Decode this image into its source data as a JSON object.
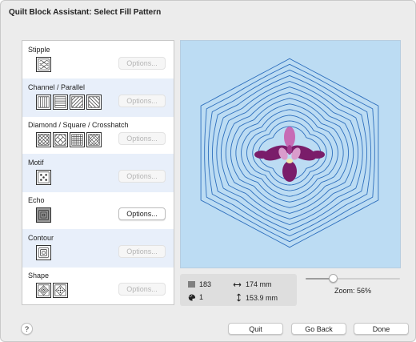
{
  "window": {
    "title": "Quilt Block Assistant: Select Fill Pattern"
  },
  "patterns": [
    {
      "label": "Stipple",
      "icons": [
        "stipple-icon"
      ],
      "options_label": "Options...",
      "options_enabled": false
    },
    {
      "label": "Channel / Parallel",
      "icons": [
        "channel-vertical-icon",
        "channel-horizontal-icon",
        "channel-diagonal-right-icon",
        "channel-diagonal-left-icon"
      ],
      "options_label": "Options...",
      "options_enabled": false
    },
    {
      "label": "Diamond / Square / Crosshatch",
      "icons": [
        "diamond-crosshatch-icon",
        "diamond-crosshatch-alt-icon",
        "square-grid-icon",
        "crosshatch-icon"
      ],
      "options_label": "Options...",
      "options_enabled": false
    },
    {
      "label": "Motif",
      "icons": [
        "motif-dots-icon"
      ],
      "options_label": "Options...",
      "options_enabled": false
    },
    {
      "label": "Echo",
      "icons": [
        "echo-icon"
      ],
      "options_label": "Options...",
      "options_enabled": true,
      "selected": true
    },
    {
      "label": "Contour",
      "icons": [
        "contour-icon"
      ],
      "options_label": "Options...",
      "options_enabled": false
    },
    {
      "label": "Shape",
      "icons": [
        "shape-diamond-icon",
        "shape-dots-icon"
      ],
      "options_label": "Options...",
      "options_enabled": false
    }
  ],
  "stats": {
    "stitch_count": "183",
    "color_count": "1",
    "width": "174 mm",
    "height": "153.9 mm"
  },
  "zoom": {
    "label": "Zoom: 56%",
    "slider_fraction": 0.27
  },
  "footer": {
    "help_label": "?",
    "quit_label": "Quit",
    "go_back_label": "Go Back",
    "done_label": "Done"
  },
  "colors": {
    "preview_bg": "#bcdcf3",
    "stitch_line": "#2e6fbd",
    "flower_purple": "#7a1d6a",
    "flower_pink": "#c76bb5",
    "selected_row_bg": "#e8effa"
  }
}
